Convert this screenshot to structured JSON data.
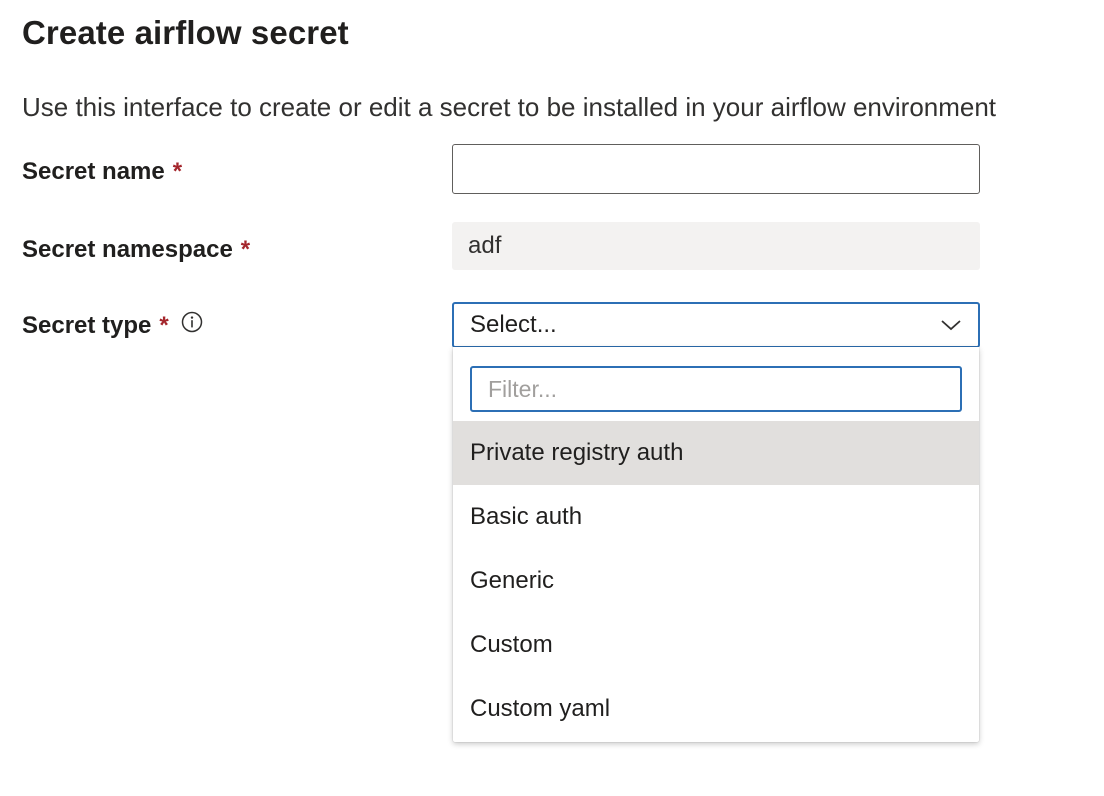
{
  "page": {
    "title": "Create airflow secret",
    "description": "Use this interface to create or edit a secret to be installed in your airflow environment"
  },
  "form": {
    "secret_name": {
      "label": "Secret name",
      "required_mark": "*",
      "value": ""
    },
    "secret_namespace": {
      "label": "Secret namespace",
      "required_mark": "*",
      "value": "adf"
    },
    "secret_type": {
      "label": "Secret type",
      "required_mark": "*",
      "info_icon": "info-icon",
      "selected": "Select...",
      "filter_placeholder": "Filter...",
      "options": [
        {
          "label": "Private registry auth",
          "highlighted": true
        },
        {
          "label": "Basic auth",
          "highlighted": false
        },
        {
          "label": "Generic",
          "highlighted": false
        },
        {
          "label": "Custom",
          "highlighted": false
        },
        {
          "label": "Custom yaml",
          "highlighted": false
        }
      ]
    }
  },
  "colors": {
    "accent": "#2c6fb5",
    "required": "#a4262c",
    "readonly_bg": "#f3f2f1",
    "highlight_bg": "#e1dfdd"
  }
}
